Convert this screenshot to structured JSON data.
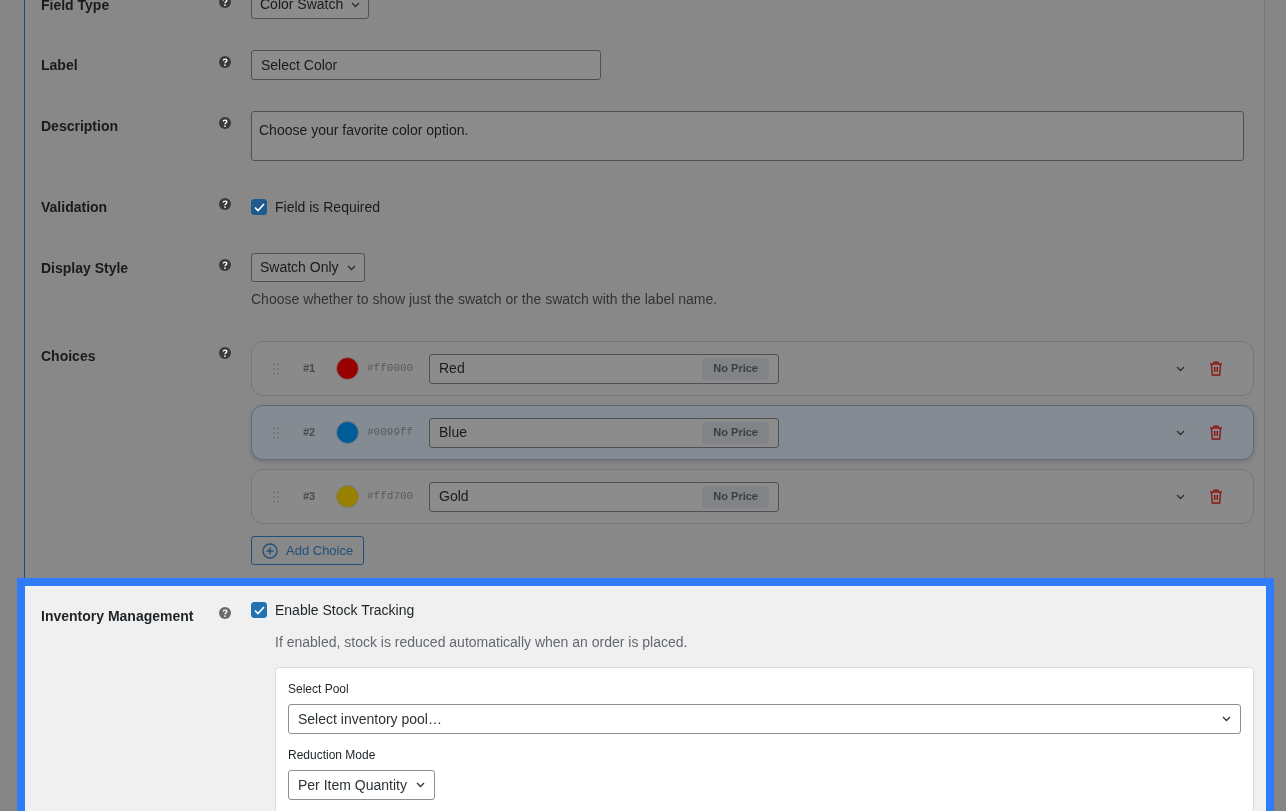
{
  "rows": [
    {
      "kind": "select",
      "label": "Field Type",
      "value": "Color Swatch"
    },
    {
      "kind": "text",
      "label": "Label",
      "value": "Select Color"
    },
    {
      "kind": "textarea",
      "label": "Description",
      "value": "Choose your favorite color option."
    },
    {
      "kind": "checkbox",
      "label": "Validation",
      "option": "Field is Required",
      "checked": true
    },
    {
      "kind": "select",
      "label": "Display Style",
      "value": "Swatch Only",
      "hint": "Choose whether to show just the swatch or the swatch with the label name."
    },
    {
      "kind": "choices",
      "label": "Choices",
      "add_button": "Add Choice",
      "choices": [
        {
          "number": "#1",
          "color": "#990000",
          "hex": "#ff0000",
          "name": "Red",
          "price": "No Price",
          "selected": false
        },
        {
          "number": "#2",
          "color": "#005c99",
          "hex": "#0099ff",
          "name": "Blue",
          "price": "No Price",
          "selected": true
        },
        {
          "number": "#3",
          "color": "#998100",
          "hex": "#ffd700",
          "name": "Gold",
          "price": "No Price",
          "selected": false
        }
      ]
    }
  ],
  "inventory": {
    "label": "Inventory Management",
    "option": "Enable Stock Tracking",
    "checked": true,
    "hint": "If enabled, stock is reduced automatically when an order is placed.",
    "pool_label": "Select Pool",
    "pool_value": "Select inventory pool…",
    "mode_label": "Reduction Mode",
    "mode_value": "Per Item Quantity"
  }
}
